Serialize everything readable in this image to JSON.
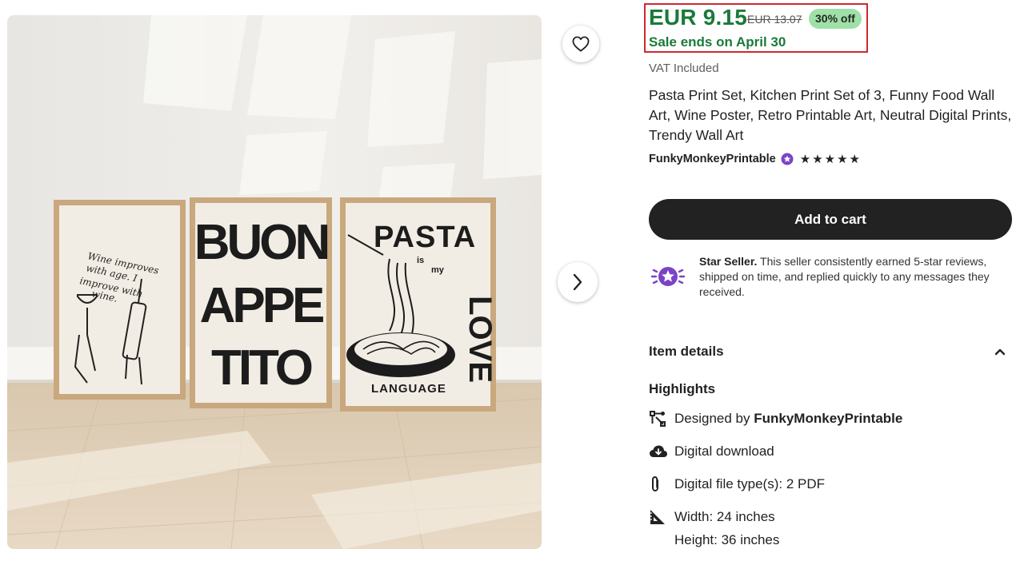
{
  "price": {
    "current": "EUR 9.15",
    "original": "EUR 13.07",
    "discount": "30% off",
    "sale_ends": "Sale ends on April 30",
    "vat": "VAT Included"
  },
  "listing": {
    "title": "Pasta Print Set, Kitchen Print Set of 3, Funny Food Wall Art, Wine Poster, Retro Printable Art, Neutral Digital Prints, Trendy Wall Art",
    "shop_name": "FunkyMonkeyPrintable",
    "rating_stars": 5
  },
  "actions": {
    "add_to_cart": "Add to cart"
  },
  "star_seller": {
    "label": "Star Seller.",
    "text": "This seller consistently earned 5-star reviews, shipped on time, and replied quickly to any messages they received."
  },
  "details": {
    "section_title": "Item details",
    "highlights_title": "Highlights",
    "designed_by_prefix": "Designed by",
    "designer": "FunkyMonkeyPrintable",
    "download": "Digital download",
    "file_type": "Digital file type(s): 2 PDF",
    "width": "Width: 24 inches",
    "height": "Height: 36 inches"
  },
  "image_text": {
    "print1_line1": "Wine improves",
    "print1_line2": "with age. I",
    "print1_line3": "improve with",
    "print1_line4": "wine.",
    "print2_line1": "BUON",
    "print2_line2": "APPE",
    "print2_line3": "TITO",
    "print3_top": "PASTA",
    "print3_small1": "is",
    "print3_small2": "my",
    "print3_side": "LOVE",
    "print3_bottom": "LANGUAGE"
  },
  "icons": {
    "favorite": "heart-icon",
    "next": "chevron-right-icon",
    "star_seller": "star-seller-badge-icon",
    "collapse": "chevron-up-icon",
    "designed_by": "designer-icon",
    "download": "cloud-download-icon",
    "file_type": "paperclip-icon",
    "dimensions": "ruler-triangle-icon"
  },
  "colors": {
    "sale_green": "#1b7a3a",
    "discount_bg": "#9fe0a8",
    "highlight_box": "#d0282e",
    "cart_button": "#222222",
    "star_seller_purple": "#7a43c8"
  }
}
